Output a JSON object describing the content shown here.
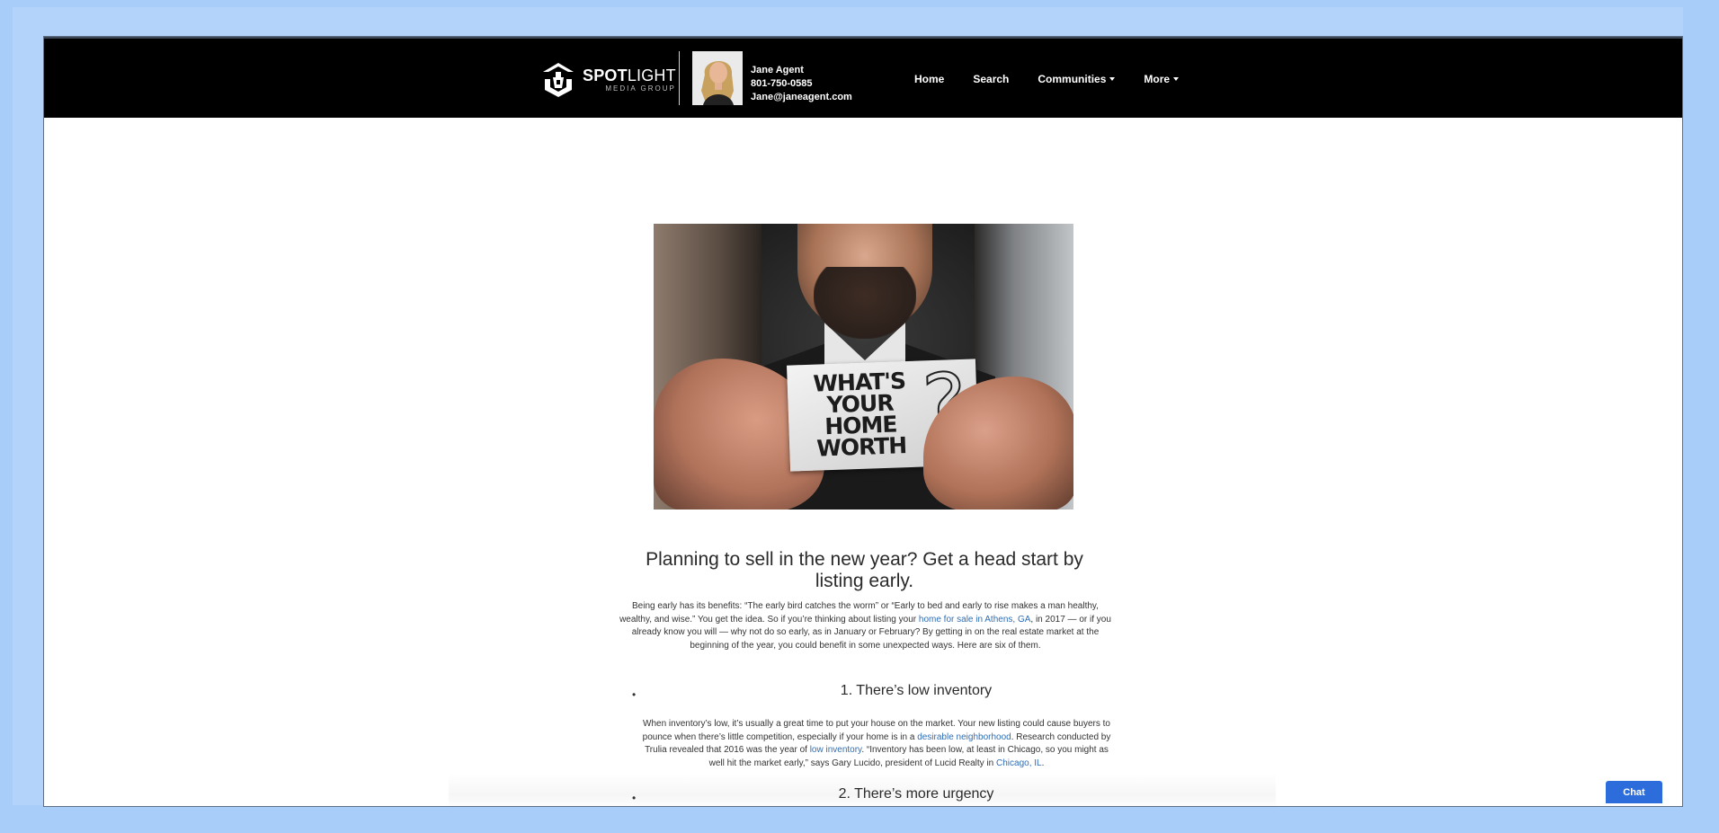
{
  "header": {
    "logo": {
      "brand": "SPOTLIGHT",
      "brand_bold": "SPOT",
      "brand_light": "LIGHT",
      "tagline": "MEDIA GROUP"
    },
    "agent": {
      "name": "Jane Agent",
      "phone": "801-750-0585",
      "email": "Jane@janeagent.com"
    },
    "nav": [
      {
        "label": "Home",
        "dropdown": false
      },
      {
        "label": "Search",
        "dropdown": false
      },
      {
        "label": "Communities",
        "dropdown": true
      },
      {
        "label": "More",
        "dropdown": true
      }
    ]
  },
  "hero": {
    "card_lines": [
      "WHAT'S",
      "YOUR",
      "HOME",
      "WORTH"
    ],
    "card_qmark": "?"
  },
  "article": {
    "headline": "Planning to sell in the new year? Get a head start by listing early.",
    "intro": {
      "part1": "Being early has its benefits: “The early bird catches the worm” or “Early to bed and early to rise makes a man healthy, wealthy, and wise.” You get the idea. So if you’re thinking about listing your ",
      "link1": "home for sale in Athens, GA",
      "part2": ", in 2017 — or if you already know you will — why not do so early, as in January or February? By getting in on the real estate market at the beginning of the year, you could benefit in some unexpected ways. Here are six of them."
    },
    "sections": [
      {
        "heading": "1. There’s low inventory",
        "p1": "When inventory’s low, it’s usually a great time to put your house on the market. Your new listing could cause buyers to pounce when there’s little competition, especially if your home is in a ",
        "link1": "desirable neighborhood",
        "p2": ". Research conducted by Trulia revealed that 2016 was the year of ",
        "link2": "low inventory",
        "p3": ". “Inventory has been low, at least in Chicago, so you might as well hit the market early,” says Gary Lucido, president of Lucid Realty in ",
        "link3": "Chicago, IL",
        "p4": "."
      },
      {
        "heading": "2. There’s more urgency"
      }
    ]
  },
  "chat": {
    "label": "Chat"
  },
  "colors": {
    "page_bg": "#a9cdf9",
    "header_bg": "#000000",
    "link": "#2f6db3",
    "chat_bg": "#2d6cdb"
  }
}
